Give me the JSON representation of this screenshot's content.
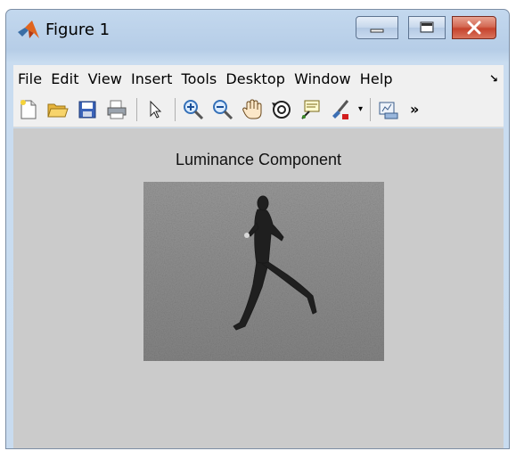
{
  "window": {
    "title": "Figure 1"
  },
  "menu": {
    "items": [
      "File",
      "Edit",
      "View",
      "Insert",
      "Tools",
      "Desktop",
      "Window",
      "Help"
    ],
    "overflow_glyph": "↘"
  },
  "toolbar": {
    "buttons": [
      {
        "icon": "new-figure-icon"
      },
      {
        "icon": "open-file-icon"
      },
      {
        "icon": "save-figure-icon"
      },
      {
        "icon": "print-figure-icon"
      },
      {
        "icon": "edit-plot-arrow-icon"
      },
      {
        "icon": "zoom-in-icon"
      },
      {
        "icon": "zoom-out-icon"
      },
      {
        "icon": "pan-hand-icon"
      },
      {
        "icon": "rotate-3d-icon"
      },
      {
        "icon": "data-cursor-icon"
      },
      {
        "icon": "brush-icon"
      },
      {
        "icon": "link-plot-icon"
      }
    ],
    "more_glyph": "»"
  },
  "figure": {
    "title": "Luminance Component",
    "image_description_icon": "grayscale-image"
  },
  "colors": {
    "figure_background": "#cbcbcb",
    "window_chrome": "#c3d8ee",
    "close_button": "#c5432d",
    "matlab_logo": "#e0641e"
  }
}
